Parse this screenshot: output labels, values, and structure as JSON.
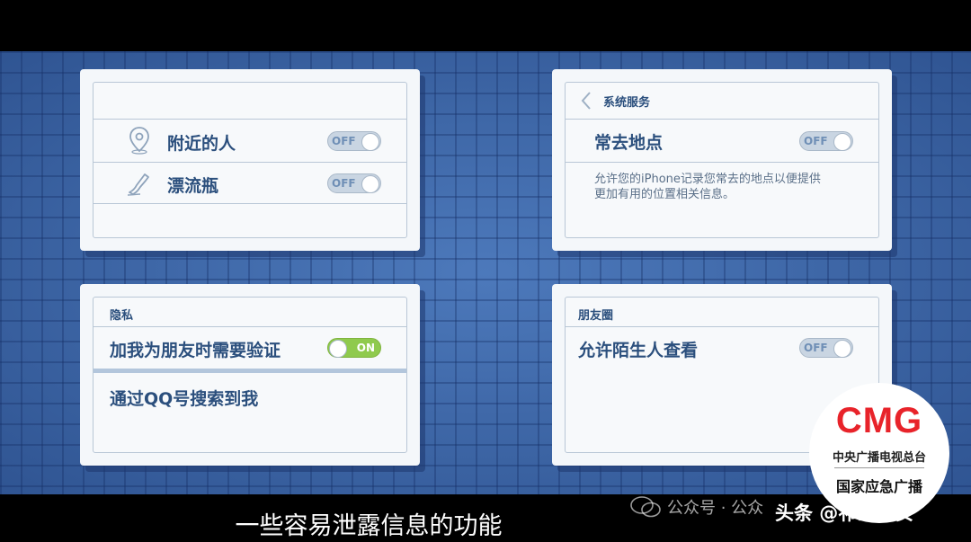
{
  "cards": {
    "nearby": {
      "items": [
        {
          "label": "附近的人",
          "toggle": "OFF"
        },
        {
          "label": "漂流瓶",
          "toggle": "OFF"
        }
      ]
    },
    "system": {
      "header": "系统服务",
      "item_label": "常去地点",
      "toggle": "OFF",
      "description_line1": "允许您的iPhone记录您常去的地点以便提供",
      "description_line2": "更加有用的位置相关信息。"
    },
    "privacy": {
      "header": "隐私",
      "item1_label": "加我为朋友时需要验证",
      "item1_toggle": "ON",
      "item2_label": "通过QQ号搜索到我"
    },
    "moments": {
      "header": "朋友圈",
      "item_label": "允许陌生人查看",
      "toggle": "OFF"
    }
  },
  "subtitle": "一些容易泄露信息的功能",
  "logo": {
    "name": "CMG",
    "line1": "中央广播电视总台",
    "line2": "国家应急广播"
  },
  "watermark": "公众号 · 公众",
  "brand": "头条 @祁东公安",
  "colors": {
    "card_text": "#2b4f7d",
    "toggle_on": "#8fca4d",
    "logo_red": "#e8232a"
  }
}
